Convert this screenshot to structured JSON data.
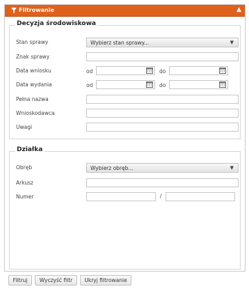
{
  "header": {
    "title": "Filtrowanie",
    "collapse_icon": "chevron-up-icon"
  },
  "decision": {
    "legend": "Decyzja środowiskowa",
    "status_label": "Stan sprawy",
    "status_value": "Wybierz stan sprawy...",
    "sign_label": "Znak sprawy",
    "app_date_label": "Data wniosku",
    "issue_date_label": "Data wydania",
    "from_label": "od",
    "to_label": "do",
    "full_name_label": "Pełna nazwa",
    "applicant_label": "Wnioskodawca",
    "notes_label": "Uwagi"
  },
  "parcel": {
    "legend": "Działka",
    "precinct_label": "Obręb",
    "precinct_value": "Wybierz obręb...",
    "sheet_label": "Arkusz",
    "number_label": "Numer",
    "number_sep": "/"
  },
  "buttons": {
    "filter": "Filtruj",
    "clear": "Wyczyść filtr",
    "hide": "Ukryj filtrowanie"
  },
  "colors": {
    "header": "#e0611c"
  }
}
